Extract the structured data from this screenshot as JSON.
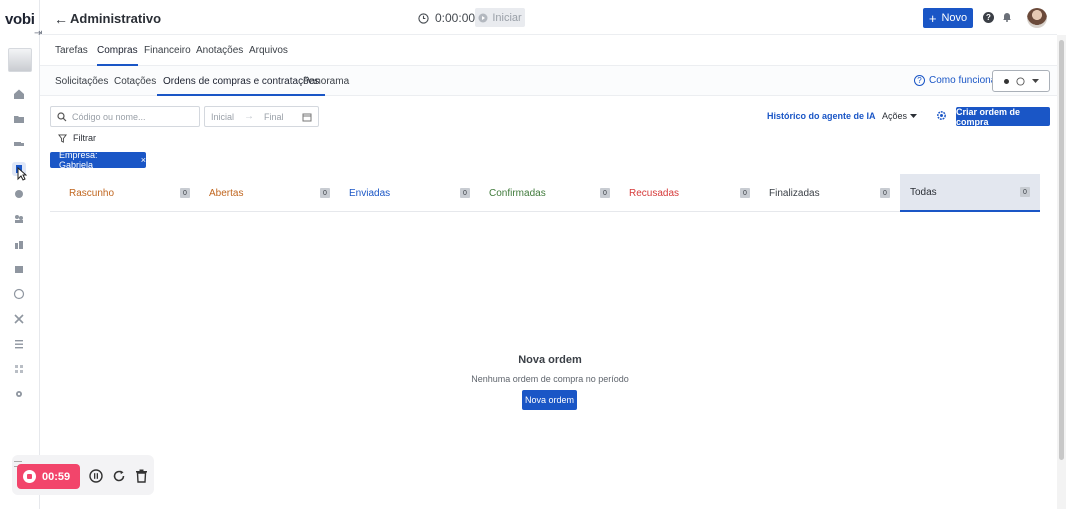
{
  "app": {
    "logo": "vobi"
  },
  "header": {
    "title": "Administrativo",
    "timer": "0:00:00",
    "start_label": "Iniciar",
    "new_label": "Novo"
  },
  "main_tabs": [
    {
      "label": "Tarefas",
      "active": false
    },
    {
      "label": "Compras",
      "active": true
    },
    {
      "label": "Financeiro",
      "active": false
    },
    {
      "label": "Anotações",
      "active": false
    },
    {
      "label": "Arquivos",
      "active": false
    }
  ],
  "sub_tabs": [
    {
      "label": "Solicitações",
      "active": false
    },
    {
      "label": "Cotações",
      "active": false
    },
    {
      "label": "Ordens de compras e contratações",
      "active": true
    },
    {
      "label": "Panorama",
      "active": false
    }
  ],
  "help_link": "Como funciona",
  "toolbar": {
    "search_placeholder": "Código ou nome...",
    "date_start_placeholder": "Inicial",
    "date_end_placeholder": "Final",
    "history_label": "Histórico do agente de IA",
    "actions_label": "Ações",
    "create_label": "Criar ordem de compra",
    "filter_label": "Filtrar",
    "chip_label": "Empresa: Gabriela"
  },
  "status_tabs": [
    {
      "label": "Rascunho",
      "count": "0",
      "color": "#c0661f",
      "active": false
    },
    {
      "label": "Abertas",
      "count": "0",
      "color": "#c0661f",
      "active": false
    },
    {
      "label": "Enviadas",
      "count": "0",
      "color": "#1a56c6",
      "active": false
    },
    {
      "label": "Confirmadas",
      "count": "0",
      "color": "#3f7a3a",
      "active": false
    },
    {
      "label": "Recusadas",
      "count": "0",
      "color": "#d63a3a",
      "active": false
    },
    {
      "label": "Finalizadas",
      "count": "0",
      "color": "#3b4047",
      "active": false
    },
    {
      "label": "Todas",
      "count": "0",
      "color": "#2b2f36",
      "active": true
    }
  ],
  "empty_state": {
    "title": "Nova ordem",
    "subtitle": "Nenhuma ordem de compra no período",
    "button": "Nova ordem"
  },
  "recorder": {
    "time": "00:59"
  },
  "colors": {
    "primary": "#1a56c6",
    "recorder": "#f2456b"
  }
}
